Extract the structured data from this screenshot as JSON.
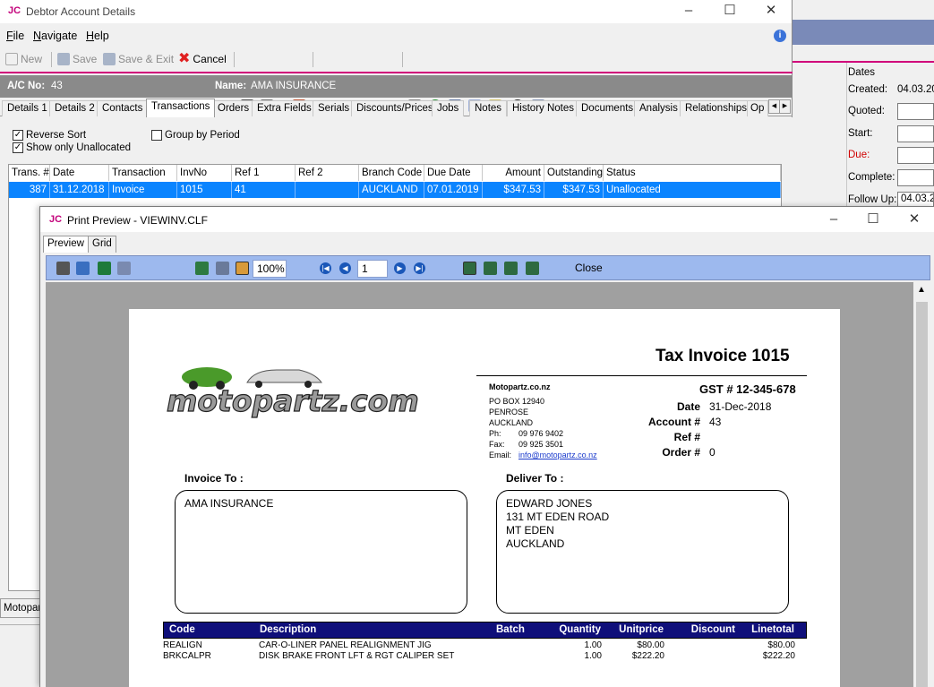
{
  "background_window": {
    "section_title": "Dates",
    "fields": [
      {
        "label": "Created:",
        "value": "04.03.20",
        "red": false,
        "boxed": false
      },
      {
        "label": "Quoted:",
        "value": "",
        "red": false,
        "boxed": true
      },
      {
        "label": "Start:",
        "value": "",
        "red": false,
        "boxed": true
      },
      {
        "label": "Due:",
        "value": "",
        "red": true,
        "boxed": true
      },
      {
        "label": "Complete:",
        "value": "",
        "red": false,
        "boxed": true
      },
      {
        "label": "Follow Up:",
        "value": "04.03.2",
        "red": false,
        "boxed": true
      }
    ]
  },
  "debtor_window": {
    "logo": "JC",
    "title": "Debtor Account Details",
    "menu": [
      "File",
      "Navigate",
      "Help"
    ],
    "toolbar": {
      "new": "New",
      "save": "Save",
      "save_exit": "Save & Exit",
      "cancel": "Cancel"
    },
    "account": {
      "ac_label": "A/C No:",
      "ac_value": "43",
      "name_label": "Name:",
      "name_value": "AMA INSURANCE"
    },
    "tabs": [
      "Details 1",
      "Details 2",
      "Contacts",
      "Transactions",
      "Orders",
      "Extra Fields",
      "Serials",
      "Discounts/Prices",
      "Jobs",
      "Notes",
      "History Notes",
      "Documents",
      "Analysis",
      "Relationships",
      "Op"
    ],
    "active_tab": "Transactions",
    "options": {
      "reverse_sort": "Reverse Sort",
      "show_unallocated": "Show only Unallocated",
      "group_by_period": "Group by Period"
    },
    "grid": {
      "columns": [
        "Trans. #",
        "Date",
        "Transaction",
        "InvNo",
        "Ref 1",
        "Ref 2",
        "Branch Code",
        "Due Date",
        "Amount",
        "Outstanding",
        "Status"
      ],
      "rows": [
        [
          "387",
          "31.12.2018",
          "Invoice",
          "1015",
          "41",
          "",
          "AUCKLAND",
          "07.01.2019",
          "$347.53",
          "$347.53",
          "Unallocated"
        ]
      ]
    },
    "bottom_tab": "Motopar"
  },
  "preview_window": {
    "logo": "JC",
    "title": "Print Preview - VIEWINV.CLF",
    "tabs": [
      "Preview",
      "Grid"
    ],
    "zoom": "100%",
    "page_number": "1",
    "close_label": "Close"
  },
  "invoice": {
    "title": "Tax Invoice 1015",
    "logo_text": "motopartz.com",
    "company": {
      "name": "Motopartz.co.nz",
      "po_box": "PO BOX 12940",
      "suburb": "PENROSE",
      "city": "AUCKLAND",
      "ph_label": "Ph:",
      "ph": "09 976 9402",
      "fax_label": "Fax:",
      "fax": "09 925 3501",
      "email_label": "Email:",
      "email": "info@motopartz.co.nz"
    },
    "gst": "GST # 12-345-678",
    "meta": [
      {
        "label": "Date",
        "value": "31-Dec-2018"
      },
      {
        "label": "Account #",
        "value": "43"
      },
      {
        "label": "Ref #",
        "value": ""
      },
      {
        "label": "Order #",
        "value": "0"
      }
    ],
    "invoice_to_label": "Invoice To :",
    "invoice_to_lines": [
      "AMA INSURANCE"
    ],
    "deliver_to_label": "Deliver To :",
    "deliver_to_lines": [
      "EDWARD JONES",
      "131 MT EDEN ROAD",
      "MT EDEN",
      "AUCKLAND"
    ],
    "items_header": [
      "Code",
      "Description",
      "Batch",
      "Quantity",
      "Unitprice",
      "Discount",
      "Linetotal"
    ],
    "items": [
      [
        "REALIGN",
        "CAR-O-LINER PANEL REALIGNMENT JIG",
        "",
        "1.00",
        "$80.00",
        "",
        "$80.00"
      ],
      [
        "BRKCALPR",
        "DISK BRAKE FRONT LFT & RGT CALIPER SET",
        "",
        "1.00",
        "$222.20",
        "",
        "$222.20"
      ]
    ]
  }
}
